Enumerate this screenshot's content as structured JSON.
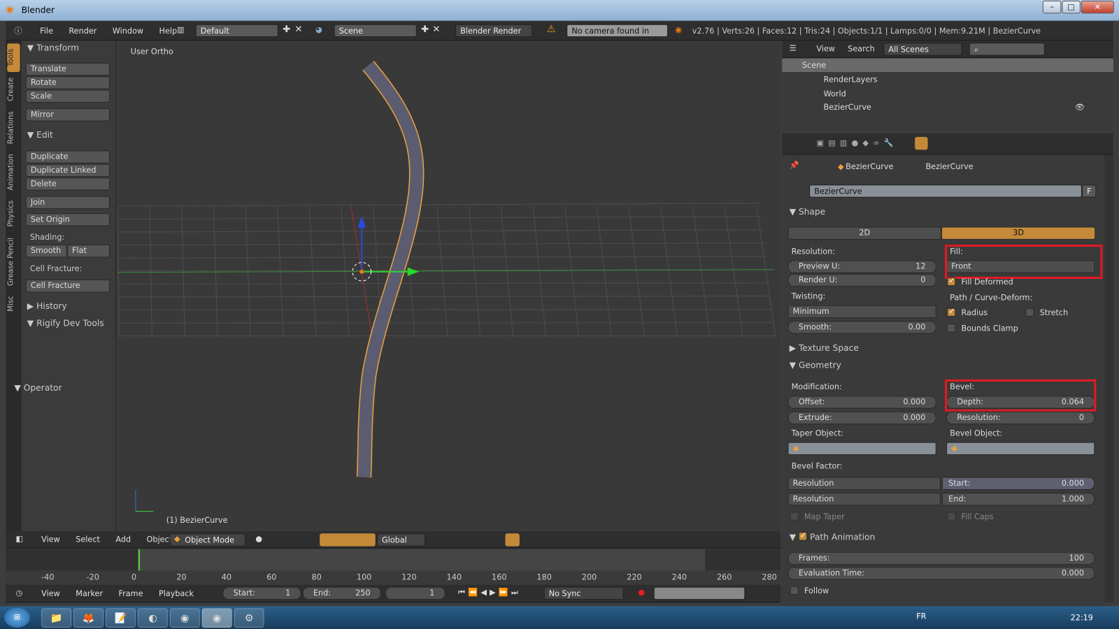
{
  "window": {
    "title": "Blender"
  },
  "info_header": {
    "menus": [
      "File",
      "Render",
      "Window",
      "Help"
    ],
    "layout": "Default",
    "scene": "Scene",
    "engine": "Blender Render",
    "warning": "No camera found in scene",
    "stats": "v2.76 | Verts:26 | Faces:12 | Tris:24 | Objects:1/1 | Lamps:0/0 | Mem:9.21M | BezierCurve"
  },
  "tool_tabs": [
    "Tools",
    "Create",
    "Relations",
    "Animation",
    "Physics",
    "Grease Pencil",
    "Misc"
  ],
  "toolshelf": {
    "transform": "Transform",
    "translate": "Translate",
    "rotate": "Rotate",
    "scale": "Scale",
    "mirror": "Mirror",
    "edit": "Edit",
    "duplicate": "Duplicate",
    "duplicate_linked": "Duplicate Linked",
    "delete": "Delete",
    "join": "Join",
    "set_origin": "Set Origin",
    "shading": "Shading:",
    "smooth": "Smooth",
    "flat": "Flat",
    "cell_fracture_label": "Cell Fracture:",
    "cell_fracture": "Cell Fracture",
    "history": "History",
    "rigify": "Rigify Dev Tools",
    "operator": "Operator"
  },
  "viewport": {
    "view_name": "User Ortho",
    "object_label": "(1) BezierCurve",
    "menus": [
      "View",
      "Select",
      "Add",
      "Object"
    ],
    "mode": "Object Mode",
    "orientation": "Global"
  },
  "timeline": {
    "ticks": [
      "-40",
      "-20",
      "0",
      "20",
      "40",
      "60",
      "80",
      "100",
      "120",
      "140",
      "160",
      "180",
      "200",
      "220",
      "240",
      "260",
      "280"
    ],
    "current_frame": "1",
    "menus": [
      "View",
      "Marker",
      "Frame",
      "Playback"
    ],
    "start_label": "Start:",
    "start": "1",
    "end_label": "End:",
    "end": "250",
    "sync": "No Sync"
  },
  "outliner": {
    "menus": [
      "View",
      "Search"
    ],
    "filter": "All Scenes",
    "items": [
      {
        "label": "Scene"
      },
      {
        "label": "RenderLayers"
      },
      {
        "label": "World"
      },
      {
        "label": "BezierCurve"
      }
    ]
  },
  "properties": {
    "breadcrumb": [
      "BezierCurve",
      "BezierCurve"
    ],
    "datablock": "BezierCurve",
    "fake_user": "F",
    "shape": {
      "title": "Shape",
      "tab_2d": "2D",
      "tab_3d": "3D",
      "resolution": "Resolution:",
      "preview_u_label": "Preview U:",
      "preview_u": "12",
      "render_u_label": "Render U:",
      "render_u": "0",
      "fill_label": "Fill:",
      "fill": "Front",
      "fill_deformed": "Fill Deformed",
      "twisting": "Twisting:",
      "twist_mode": "Minimum",
      "smooth_label": "Smooth:",
      "smooth": "0.00",
      "path_deform": "Path / Curve-Deform:",
      "radius": "Radius",
      "stretch": "Stretch",
      "bounds_clamp": "Bounds Clamp"
    },
    "texture_space": "Texture Space",
    "geometry": {
      "title": "Geometry",
      "modification": "Modification:",
      "offset_label": "Offset:",
      "offset": "0.000",
      "extrude_label": "Extrude:",
      "extrude": "0.000",
      "bevel": "Bevel:",
      "depth_label": "Depth:",
      "depth": "0.064",
      "resolution_label": "Resolution:",
      "resolution": "0",
      "taper_object": "Taper Object:",
      "bevel_object": "Bevel Object:",
      "bevel_factor": "Bevel Factor:",
      "factor_mode1": "Resolution",
      "factor_mode2": "Resolution",
      "start_label": "Start:",
      "start": "0.000",
      "end_label": "End:",
      "end": "1.000",
      "map_taper": "Map Taper",
      "fill_caps": "Fill Caps"
    },
    "path_animation": {
      "title": "Path Animation",
      "frames_label": "Frames:",
      "frames": "100",
      "eval_label": "Evaluation Time:",
      "eval": "0.000",
      "follow": "Follow"
    }
  },
  "taskbar": {
    "lang": "FR",
    "time": "22:19"
  },
  "colors": {
    "accent": "#c48a3a",
    "highlight": "#e01b24"
  }
}
